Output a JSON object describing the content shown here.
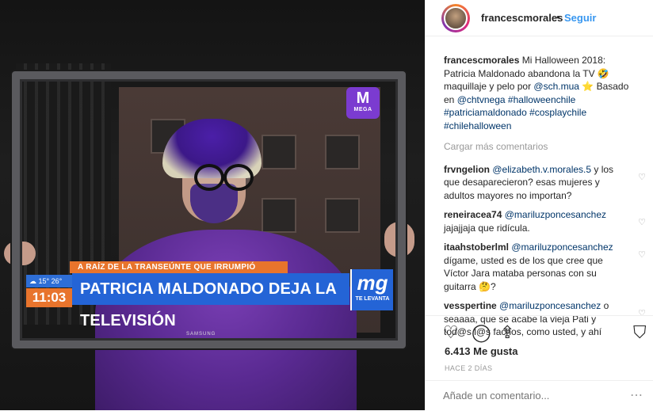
{
  "photo": {
    "tv": {
      "channel_logo": "MEGA",
      "brand": "SAMSUNG",
      "ticker": "A RAÍZ DE LA TRANSEÚNTE QUE IRRUMPIÓ DESPACHO",
      "weather_low": "15°",
      "weather_high": "26°",
      "clock": "11:03",
      "headline": "PATRICIA MALDONADO DEJA LA TELEVISIÓN",
      "show_logo": "mg",
      "show_sub": "TE LEVANTA"
    }
  },
  "header": {
    "username": "francescmorales",
    "separator": "•",
    "follow_label": "Seguir"
  },
  "caption": {
    "user": "francescmorales",
    "text1": " Mi Halloween 2018: Patricia Maldonado abandona la TV 🤣 maquillaje y pelo por ",
    "mention1": "@sch.mua",
    "text2": " ⭐ Basado en ",
    "mention2": "@chtvnega",
    "text3": " ",
    "tags": "#halloweenchile #patriciamaldonado #cosplaychile #chilehalloween"
  },
  "load_more": "Cargar más comentarios",
  "comments": [
    {
      "user": "frvngelion",
      "mention": "@elizabeth.v.morales.5",
      "text": " y los que desaparecieron? esas mujeres y adultos mayores no importan?"
    },
    {
      "user": "reneiracea74",
      "mention": "@mariluzponcesanchez",
      "text": " jajajjaja que ridícula."
    },
    {
      "user": "itaahstoberlml",
      "mention": "@mariluzponcesanchez",
      "text": " dígame, usted es de los que cree que Víctor Jara mataba personas con su guitarra 🤔?"
    },
    {
      "user": "vesspertine",
      "mention": "@mariluzponcesanchez",
      "text": " o seaaaa, que se acabe la vieja Pati y tod@s l@s fachos, como usted, y ahí"
    }
  ],
  "icons": {
    "heart": "♡",
    "like": "♡",
    "comment": "◯",
    "share": "⇪",
    "save": "⛉",
    "more": "⋯"
  },
  "likes": "6.413 Me gusta",
  "time_ago": "HACE 2 DÍAS",
  "add_comment": {
    "placeholder": "Añade un comentario..."
  }
}
